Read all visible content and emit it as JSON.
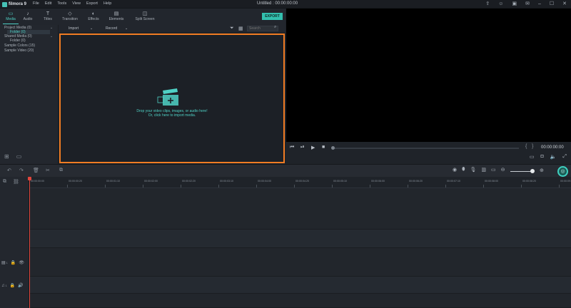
{
  "app": {
    "logo_text": "filmora 9",
    "menu": [
      "File",
      "Edit",
      "Tools",
      "View",
      "Export",
      "Help"
    ],
    "doc_title": "Untitled : 00:00:00:00"
  },
  "window_icons": [
    "upload-icon",
    "account-icon",
    "gift-icon",
    "mail-icon",
    "minimize-icon",
    "maximize-icon",
    "close-icon"
  ],
  "media_tabs": [
    {
      "label": "Media",
      "icon": "folder-icon",
      "active": true
    },
    {
      "label": "Audio",
      "icon": "music-note-icon",
      "active": false
    },
    {
      "label": "Titles",
      "icon": "text-icon",
      "active": false
    },
    {
      "label": "Transition",
      "icon": "transition-icon",
      "active": false
    },
    {
      "label": "Effects",
      "icon": "effects-icon",
      "active": false
    },
    {
      "label": "Elements",
      "icon": "elements-icon",
      "active": false
    },
    {
      "label": "Split Screen",
      "icon": "split-screen-icon",
      "active": false
    }
  ],
  "export_label": "EXPORT",
  "folders": [
    {
      "label": "Project Media (0)",
      "level": 0,
      "selected": false
    },
    {
      "label": "Folder (0)",
      "level": 1,
      "selected": true
    },
    {
      "label": "Shared Media (0)",
      "level": 0,
      "selected": false
    },
    {
      "label": "Folder (0)",
      "level": 1,
      "selected": false
    },
    {
      "label": "Sample Colors (15)",
      "level": 0,
      "selected": false
    },
    {
      "label": "Sample Video (20)",
      "level": 0,
      "selected": false
    }
  ],
  "import_bar": {
    "import_label": "Import",
    "record_label": "Record",
    "search_placeholder": "Search"
  },
  "dropzone": {
    "line1": "Drop your video clips, images, or audio here!",
    "line2": "Or, click here to import media."
  },
  "preview": {
    "timecode": "00:00:00:00"
  },
  "ruler_ticks": [
    "00:00:00:00",
    "00:00:00:20",
    "00:00:01:10",
    "00:00:02:00",
    "00:00:02:20",
    "00:00:03:10",
    "00:00:04:00",
    "00:00:04:20",
    "00:00:05:10",
    "00:00:06:00",
    "00:00:06:20",
    "00:00:07:10",
    "00:00:08:00",
    "00:00:08:20",
    "00:00:09:10"
  ],
  "tracks": [
    {
      "type": "video",
      "number": "1"
    },
    {
      "type": "audio",
      "number": "1"
    }
  ],
  "colors": {
    "accent": "#4fd1c5",
    "dropzone_border": "#f07c23",
    "playhead": "#e2463c"
  }
}
